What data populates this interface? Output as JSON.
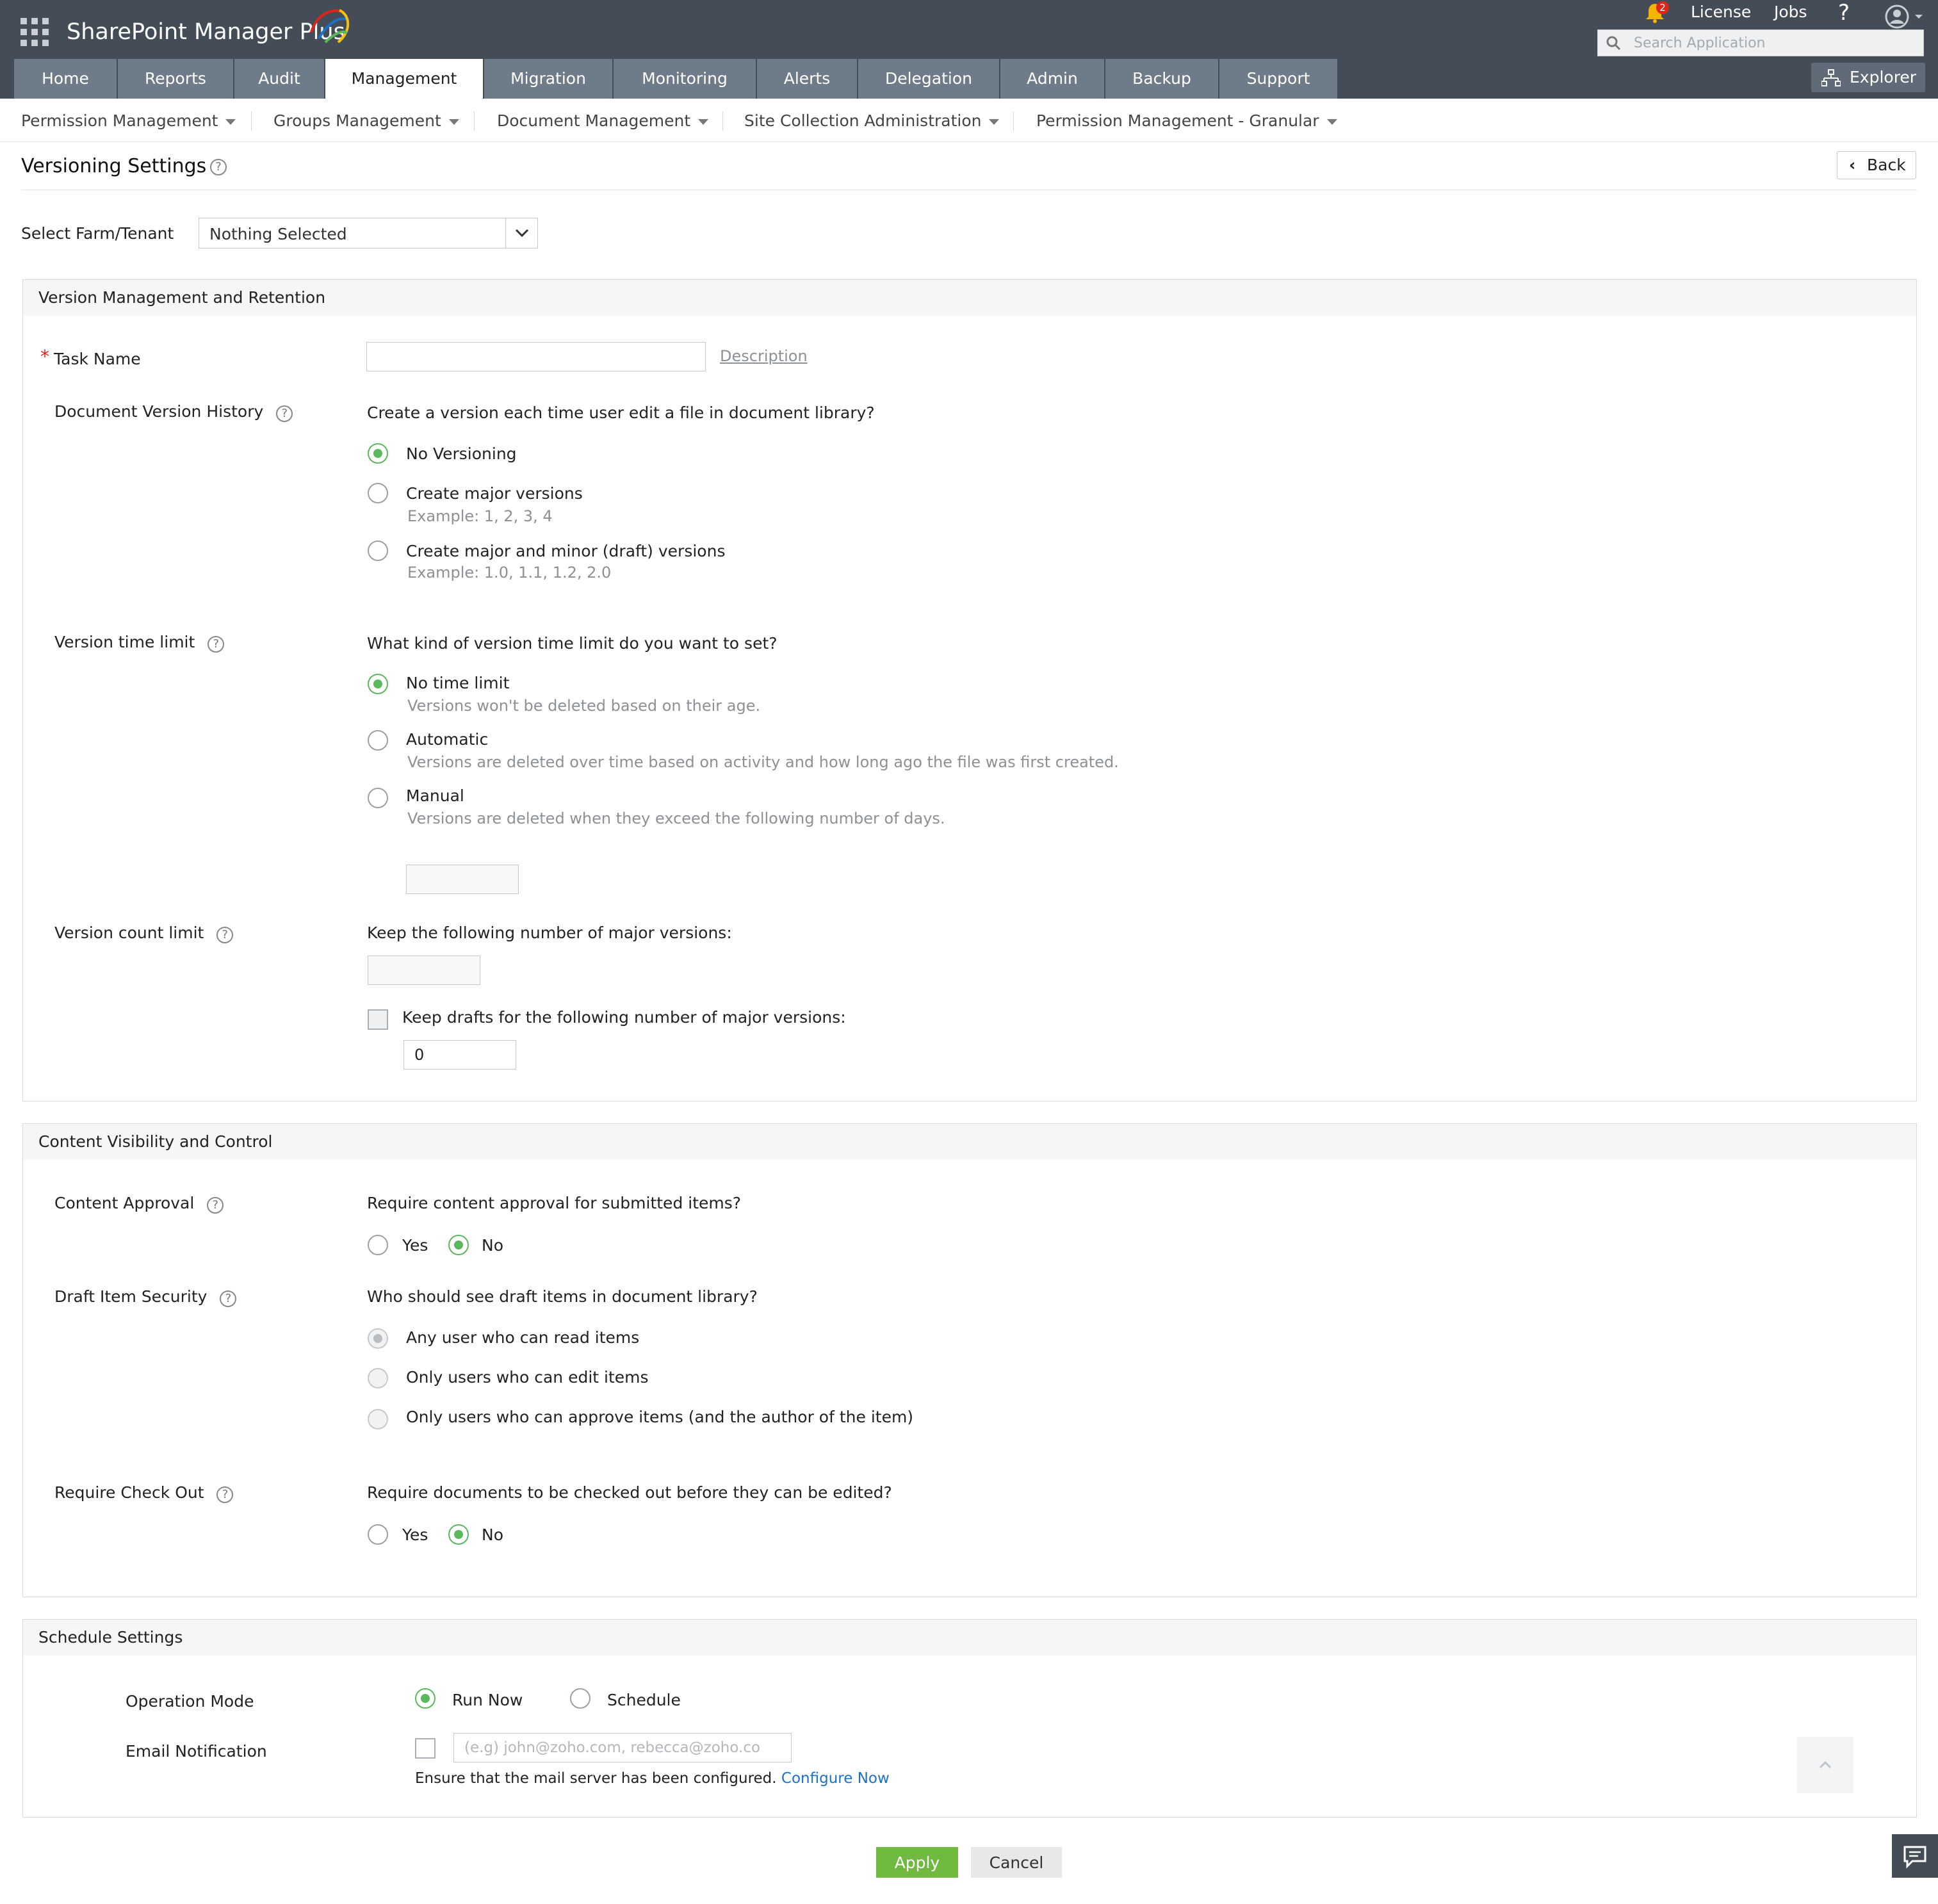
{
  "app": {
    "title": "SharePoint Manager Plus",
    "notification_count": "2",
    "license": "License",
    "jobs": "Jobs",
    "help": "?",
    "search_placeholder": "Search Application",
    "explorer": "Explorer"
  },
  "tabs": [
    "Home",
    "Reports",
    "Audit",
    "Management",
    "Migration",
    "Monitoring",
    "Alerts",
    "Delegation",
    "Admin",
    "Backup",
    "Support"
  ],
  "active_tab": "Management",
  "subnav": [
    "Permission Management",
    "Groups Management",
    "Document Management",
    "Site Collection Administration",
    "Permission Management - Granular"
  ],
  "page": {
    "title": "Versioning Settings",
    "back": "Back",
    "farm_label": "Select Farm/Tenant",
    "farm_value": "Nothing Selected"
  },
  "version_panel": {
    "heading": "Version Management and Retention",
    "task_name_label": "Task Name",
    "task_name_value": "",
    "description_link": "Description",
    "doc_history": {
      "label": "Document Version History",
      "question": "Create a version each time user edit a file in document library?",
      "options": [
        {
          "label": "No Versioning",
          "example": ""
        },
        {
          "label": "Create major versions",
          "example": "Example: 1, 2, 3, 4"
        },
        {
          "label": "Create major and minor (draft) versions",
          "example": "Example: 1.0, 1.1, 1.2, 2.0"
        }
      ],
      "selected": "No Versioning"
    },
    "time_limit": {
      "label": "Version time limit",
      "question": "What kind of version time limit do you want to set?",
      "options": [
        {
          "label": "No time limit",
          "note": "Versions won't be deleted based on their age."
        },
        {
          "label": "Automatic",
          "note": "Versions are deleted over time based on activity and how long ago the file was first created."
        },
        {
          "label": "Manual",
          "note": "Versions are deleted when they exceed the following number of days."
        }
      ],
      "selected": "No time limit",
      "days_value": ""
    },
    "count_limit": {
      "label": "Version count limit",
      "question": "Keep the following number of major versions:",
      "major_value": "",
      "drafts_label": "Keep drafts for the following number of major versions:",
      "drafts_checked": false,
      "drafts_value": "0"
    }
  },
  "content_panel": {
    "heading": "Content Visibility and Control",
    "approval": {
      "label": "Content Approval",
      "question": "Require content approval for submitted items?",
      "yes": "Yes",
      "no": "No",
      "selected": "No"
    },
    "draft_security": {
      "label": "Draft Item Security",
      "question": "Who should see draft items in document library?",
      "options": [
        "Any user who can read items",
        "Only users who can edit items",
        "Only users who can approve items (and the author of the item)"
      ],
      "selected": "Any user who can read items",
      "disabled": true
    },
    "checkout": {
      "label": "Require Check Out",
      "question": "Require documents to be checked out before they can be edited?",
      "yes": "Yes",
      "no": "No",
      "selected": "No"
    }
  },
  "schedule_panel": {
    "heading": "Schedule Settings",
    "operation_mode_label": "Operation Mode",
    "run_now": "Run Now",
    "schedule": "Schedule",
    "selected": "Run Now",
    "email_label": "Email Notification",
    "email_placeholder": "(e.g) john@zoho.com, rebecca@zoho.co",
    "email_checked": false,
    "mail_note": "Ensure that the mail server has been configured.",
    "configure_link": "Configure Now"
  },
  "actions": {
    "apply": "Apply",
    "cancel": "Cancel"
  },
  "icons": [
    "apps-grid-icon",
    "bell-icon",
    "help-icon",
    "user-avatar-icon",
    "search-icon",
    "explorer-icon",
    "chevron-left-icon",
    "chevron-down-icon",
    "help-circle-icon",
    "chevron-up-icon",
    "chat-icon"
  ],
  "colors": {
    "topbar": "#444d57",
    "tab": "#6e7b88",
    "accent_green": "#5cb85c",
    "apply_green": "#6fba3e",
    "link_blue": "#1a73c9",
    "required_red": "#e2231a"
  }
}
